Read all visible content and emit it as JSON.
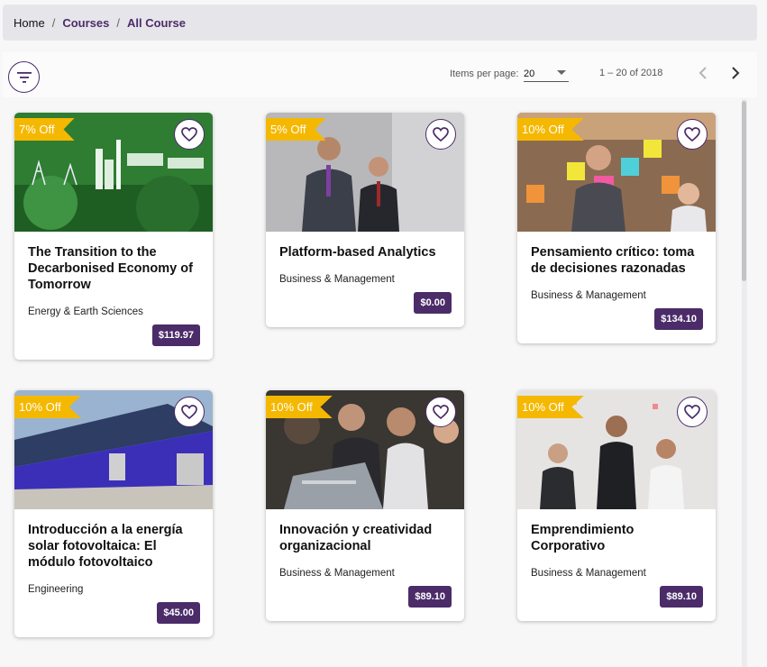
{
  "breadcrumb": {
    "home": "Home",
    "courses": "Courses",
    "current": "All Course"
  },
  "toolbar": {
    "items_per_page_label": "Items per page:",
    "items_per_page_value": "20",
    "range": "1 – 20 of 2018"
  },
  "icons": {
    "filter": "filter-icon",
    "prev": "chevron-left-icon",
    "next": "chevron-right-icon",
    "favorite": "heart-icon"
  },
  "colors": {
    "accent": "#4b2c69",
    "discount": "#f5b800"
  },
  "courses": [
    {
      "discount": "7% Off",
      "title": "The Transition to the Decarbonised Economy of Tomorrow",
      "category": "Energy & Earth Sciences",
      "price": "$119.97"
    },
    {
      "discount": "5% Off",
      "title": "Platform-based Analytics",
      "category": "Business & Management",
      "price": "$0.00"
    },
    {
      "discount": "10% Off",
      "title": "Pensamiento crítico: toma de decisiones razonadas",
      "category": "Business & Management",
      "price": "$134.10"
    },
    {
      "discount": "10% Off",
      "title": "Introducción a la energía solar fotovoltaica: El módulo fotovoltaico",
      "category": "Engineering",
      "price": "$45.00"
    },
    {
      "discount": "10% Off",
      "title": "Innovación y creatividad organizacional",
      "category": "Business & Management",
      "price": "$89.10"
    },
    {
      "discount": "10% Off",
      "title": "Emprendimiento Corporativo",
      "category": "Business & Management",
      "price": "$89.10"
    }
  ]
}
